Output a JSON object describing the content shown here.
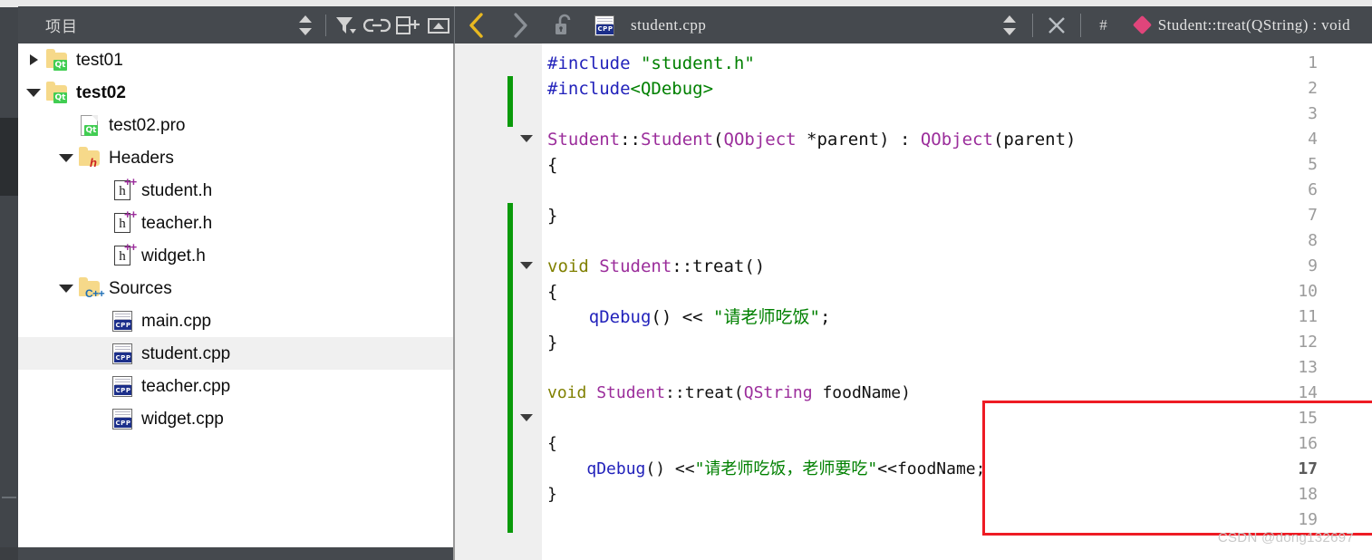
{
  "colors": {
    "toolbar_bg": "#45494e",
    "mode_strip_bg": "#41454a",
    "mode_strip_active": "#2b2e31",
    "gutter_bg": "#efefef",
    "change_bar_green": "#0a9a0a",
    "highlight_box_red": "#ee1b24",
    "symbol_diamond_pink": "#e0457b",
    "nav_back_active_yellow": "#e8b820",
    "nav_forward_inactive_gray": "#8b9096",
    "selection_row_gray": "#f0f0f0",
    "string_green": "#008000",
    "preprocessor_blue": "#2222bb",
    "type_purple": "#9b2d9b",
    "keyword_olive": "#808000"
  },
  "project_pane": {
    "toolbar": {
      "title": "项目",
      "icons": [
        {
          "name": "sort-updown-icon",
          "glyph": "updown"
        },
        {
          "name": "filter-icon",
          "glyph": "funnel"
        },
        {
          "name": "link-with-editor-icon",
          "glyph": "chain"
        },
        {
          "name": "split-pane-add-icon",
          "glyph": "split-plus"
        },
        {
          "name": "collapse-pane-icon",
          "glyph": "minimize"
        }
      ]
    },
    "tree": [
      {
        "label": "test01",
        "icon": "qt-folder-icon",
        "indent": 0,
        "twisty": "right",
        "bold": false,
        "selected": false
      },
      {
        "label": "test02",
        "icon": "qt-folder-icon",
        "indent": 0,
        "twisty": "down",
        "bold": true,
        "selected": false
      },
      {
        "label": "test02.pro",
        "icon": "qt-project-file-icon",
        "indent": 1,
        "twisty": "none",
        "bold": false,
        "selected": false
      },
      {
        "label": "Headers",
        "icon": "headers-folder-icon",
        "indent": 1,
        "twisty": "down",
        "bold": false,
        "selected": false
      },
      {
        "label": "student.h",
        "icon": "hpp-file-icon",
        "indent": 2,
        "twisty": "none",
        "bold": false,
        "selected": false
      },
      {
        "label": "teacher.h",
        "icon": "hpp-file-icon",
        "indent": 2,
        "twisty": "none",
        "bold": false,
        "selected": false
      },
      {
        "label": "widget.h",
        "icon": "hpp-file-icon",
        "indent": 2,
        "twisty": "none",
        "bold": false,
        "selected": false
      },
      {
        "label": "Sources",
        "icon": "sources-folder-icon",
        "indent": 1,
        "twisty": "down",
        "bold": false,
        "selected": false
      },
      {
        "label": "main.cpp",
        "icon": "cpp-file-icon",
        "indent": 2,
        "twisty": "none",
        "bold": false,
        "selected": false
      },
      {
        "label": "student.cpp",
        "icon": "cpp-file-icon",
        "indent": 2,
        "twisty": "none",
        "bold": false,
        "selected": true
      },
      {
        "label": "teacher.cpp",
        "icon": "cpp-file-icon",
        "indent": 2,
        "twisty": "none",
        "bold": false,
        "selected": false
      },
      {
        "label": "widget.cpp",
        "icon": "cpp-file-icon",
        "indent": 2,
        "twisty": "none",
        "bold": false,
        "selected": false
      }
    ]
  },
  "editor_pane": {
    "toolbar": {
      "back_label": "<",
      "forward_label": ">",
      "lock_state": "unlocked",
      "filename": "student.cpp",
      "file_icon": "cpp-file-icon",
      "hash_label": "#",
      "symbol": "Student::treat(QString) : void",
      "symbol_icon": "method-diamond-icon",
      "close_label": "×"
    },
    "line_numbers": [
      "1",
      "2",
      "3",
      "4",
      "5",
      "6",
      "7",
      "8",
      "9",
      "10",
      "11",
      "12",
      "13",
      "14",
      "15",
      "16",
      "17",
      "18",
      "19"
    ],
    "current_line": "17",
    "fold_marker_lines": [
      "4",
      "9",
      "15"
    ],
    "change_bar_ranges": [
      {
        "from_line": 2,
        "to_line": 3
      },
      {
        "from_line": 7,
        "to_line": 19
      }
    ],
    "code_lines": [
      {
        "line": 1,
        "tokens": [
          {
            "t": "#include ",
            "c": "pre"
          },
          {
            "t": "\"student.h\"",
            "c": "str"
          }
        ]
      },
      {
        "line": 2,
        "tokens": [
          {
            "t": "#include",
            "c": "pre"
          },
          {
            "t": "<QDebug>",
            "c": "str"
          }
        ]
      },
      {
        "line": 3,
        "tokens": []
      },
      {
        "line": 4,
        "tokens": [
          {
            "t": "Student",
            "c": "type"
          },
          {
            "t": "::",
            "c": "plain"
          },
          {
            "t": "Student",
            "c": "type"
          },
          {
            "t": "(",
            "c": "plain"
          },
          {
            "t": "QObject",
            "c": "type"
          },
          {
            "t": " *parent) : ",
            "c": "plain"
          },
          {
            "t": "QObject",
            "c": "type"
          },
          {
            "t": "(parent)",
            "c": "plain"
          }
        ]
      },
      {
        "line": 5,
        "tokens": [
          {
            "t": "{",
            "c": "plain"
          }
        ]
      },
      {
        "line": 6,
        "tokens": []
      },
      {
        "line": 7,
        "tokens": [
          {
            "t": "}",
            "c": "plain"
          }
        ]
      },
      {
        "line": 8,
        "tokens": []
      },
      {
        "line": 9,
        "tokens": [
          {
            "t": "void ",
            "c": "kw"
          },
          {
            "t": "Student",
            "c": "type"
          },
          {
            "t": "::treat()",
            "c": "plain"
          }
        ]
      },
      {
        "line": 10,
        "tokens": [
          {
            "t": "{",
            "c": "plain"
          }
        ]
      },
      {
        "line": 11,
        "tokens": [
          {
            "t": "    ",
            "c": "plain"
          },
          {
            "t": "qDebug",
            "c": "fn"
          },
          {
            "t": "() << ",
            "c": "plain"
          },
          {
            "t": "\"请老师吃饭\"",
            "c": "str"
          },
          {
            "t": ";",
            "c": "plain"
          }
        ]
      },
      {
        "line": 12,
        "tokens": [
          {
            "t": "}",
            "c": "plain"
          }
        ]
      },
      {
        "line": 13,
        "tokens": []
      },
      {
        "line": 14,
        "tokens": [
          {
            "t": "void ",
            "c": "kw"
          },
          {
            "t": "Student",
            "c": "type"
          },
          {
            "t": "::treat(",
            "c": "plain"
          },
          {
            "t": "QString",
            "c": "type"
          },
          {
            "t": " foodName)",
            "c": "plain"
          }
        ]
      },
      {
        "line": 15,
        "tokens": []
      },
      {
        "line": 16,
        "tokens": [
          {
            "t": "{",
            "c": "plain"
          }
        ]
      },
      {
        "line": 17,
        "tokens": [
          {
            "t": "    ",
            "c": "plain"
          },
          {
            "t": "qDebug",
            "c": "fn"
          },
          {
            "t": "() <<",
            "c": "plain"
          },
          {
            "t": "\"请老师吃饭，老师要吃\"",
            "c": "str"
          },
          {
            "t": "<<foodName;",
            "c": "plain"
          }
        ]
      },
      {
        "line": 18,
        "tokens": [
          {
            "t": "}",
            "c": "plain"
          }
        ]
      },
      {
        "line": 19,
        "tokens": []
      }
    ],
    "highlight_box": {
      "from_line": 14,
      "to_line": 19
    }
  },
  "watermark": "CSDN @dong132697"
}
